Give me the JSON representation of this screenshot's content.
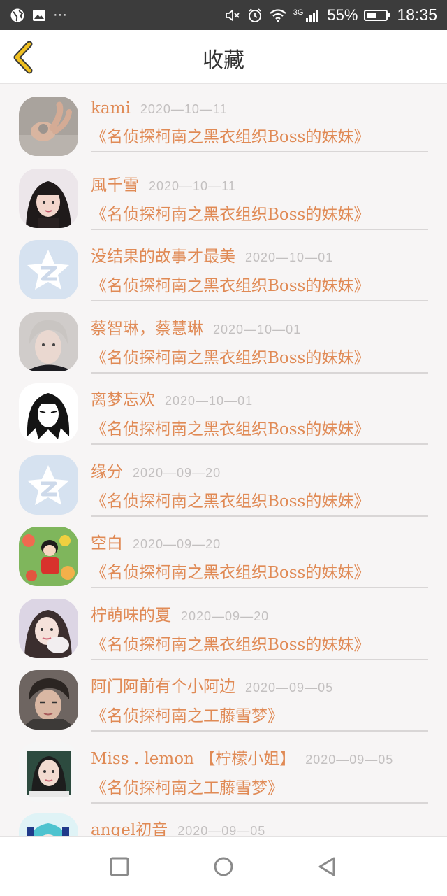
{
  "status_bar": {
    "icons": [
      "globe-icon",
      "image-icon",
      "more-dots-icon",
      "mute-icon",
      "alarm-icon",
      "wifi-icon",
      "signal-icon"
    ],
    "more": "···",
    "network": "3G",
    "battery_percent": "55%",
    "battery_level": 0.55,
    "time": "18:35"
  },
  "header": {
    "title": "收藏",
    "back_icon": "chevron-left-icon"
  },
  "favorites": [
    {
      "user": "kami",
      "date": "2020—10—11",
      "book": "《名侦探柯南之黑衣组织Boss的妹妹》",
      "avatar": "hand-photo"
    },
    {
      "user": "風千雪",
      "date": "2020—10—11",
      "book": "《名侦探柯南之黑衣组织Boss的妹妹》",
      "avatar": "girl-photo"
    },
    {
      "user": "没结果的故事才最美",
      "date": "2020—10—01",
      "book": "《名侦探柯南之黑衣组织Boss的妹妹》",
      "avatar": "qzone-default"
    },
    {
      "user": "蔡智琳，蔡慧琳",
      "date": "2020—10—01",
      "book": "《名侦探柯南之黑衣组织Boss的妹妹》",
      "avatar": "man-photo"
    },
    {
      "user": "离梦忘欢",
      "date": "2020—10—01",
      "book": "《名侦探柯南之黑衣组织Boss的妹妹》",
      "avatar": "manga-girl"
    },
    {
      "user": "缘分",
      "date": "2020—09—20",
      "book": "《名侦探柯南之黑衣组织Boss的妹妹》",
      "avatar": "qzone-default"
    },
    {
      "user": "空白",
      "date": "2020—09—20",
      "book": "《名侦探柯南之黑衣组织Boss的妹妹》",
      "avatar": "anime-flowers"
    },
    {
      "user": "柠萌味的夏",
      "date": "2020—09—20",
      "book": "《名侦探柯南之黑衣组织Boss的妹妹》",
      "avatar": "girl-photo-2"
    },
    {
      "user": "阿门阿前有个小阿边",
      "date": "2020—09—05",
      "book": "《名侦探柯南之工藤雪梦》",
      "avatar": "boy-photo"
    },
    {
      "user": "Miss . lemon 【柠檬小姐】",
      "date": "2020—09—05",
      "book": "《名侦探柯南之工藤雪梦》",
      "avatar": "girl-portrait"
    },
    {
      "user": "angel初音",
      "date": "2020—09—05",
      "book": "",
      "avatar": "miku"
    }
  ],
  "bottom_nav": {
    "icons": [
      "recents-square-icon",
      "home-circle-icon",
      "back-triangle-icon"
    ]
  },
  "colors": {
    "accent": "#e08a55",
    "date": "#c3c0c0",
    "back_icon": "#f0c020"
  }
}
